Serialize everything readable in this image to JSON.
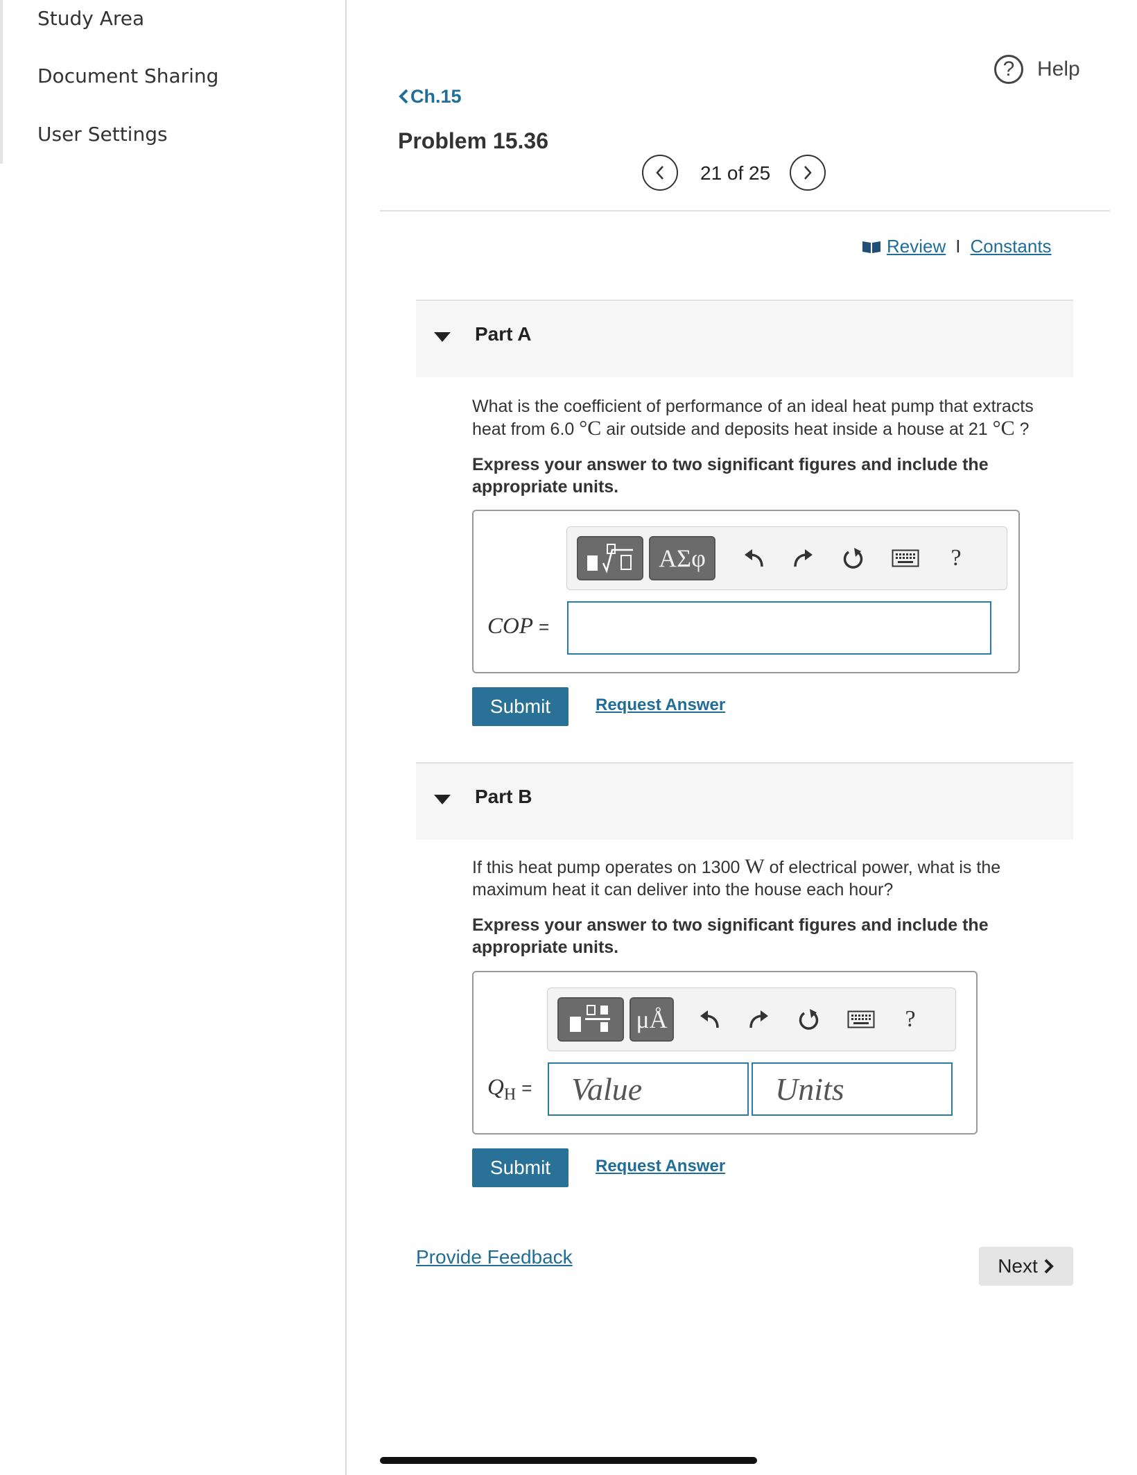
{
  "sidebar": {
    "items": [
      {
        "label": "Study Area"
      },
      {
        "label": "Document Sharing"
      },
      {
        "label": "User Settings"
      }
    ]
  },
  "header": {
    "help_label": "Help",
    "help_symbol": "?",
    "back_label": "Ch.15",
    "problem_title": "Problem 15.36",
    "pagination": "21 of 25"
  },
  "links": {
    "review": "Review",
    "separator": "I",
    "constants": "Constants"
  },
  "part_a": {
    "label": "Part A",
    "question_1": "What is the coefficient of performance of an ideal heat pump that extracts heat from 6.0",
    "unit_1": "°C",
    "question_2": "air outside and deposits heat inside a house at 21",
    "unit_2": "°C",
    "question_3": "?",
    "instruction": "Express your answer to two significant figures and include the appropriate units.",
    "toolbar_greek": "ΑΣφ",
    "toolbar_help": "?",
    "variable": "COP",
    "equals": "=",
    "input_value": "",
    "submit": "Submit",
    "request_answer": "Request Answer"
  },
  "part_b": {
    "label": "Part B",
    "question_1": "If this heat pump operates on 1300",
    "unit_1": "W",
    "question_2": "of electrical power, what is the maximum heat it can deliver into the house each hour?",
    "instruction": "Express your answer to two significant figures and include the appropriate units.",
    "toolbar_units": "μÅ",
    "toolbar_help": "?",
    "variable": "Q",
    "variable_sub": "H",
    "equals": "=",
    "value_placeholder": "Value",
    "units_placeholder": "Units",
    "submit": "Submit",
    "request_answer": "Request Answer"
  },
  "footer": {
    "feedback": "Provide Feedback",
    "next": "Next"
  },
  "colors": {
    "link": "#1f6d98",
    "submit_bg": "#2a7197",
    "input_border": "#2a7aa8"
  }
}
